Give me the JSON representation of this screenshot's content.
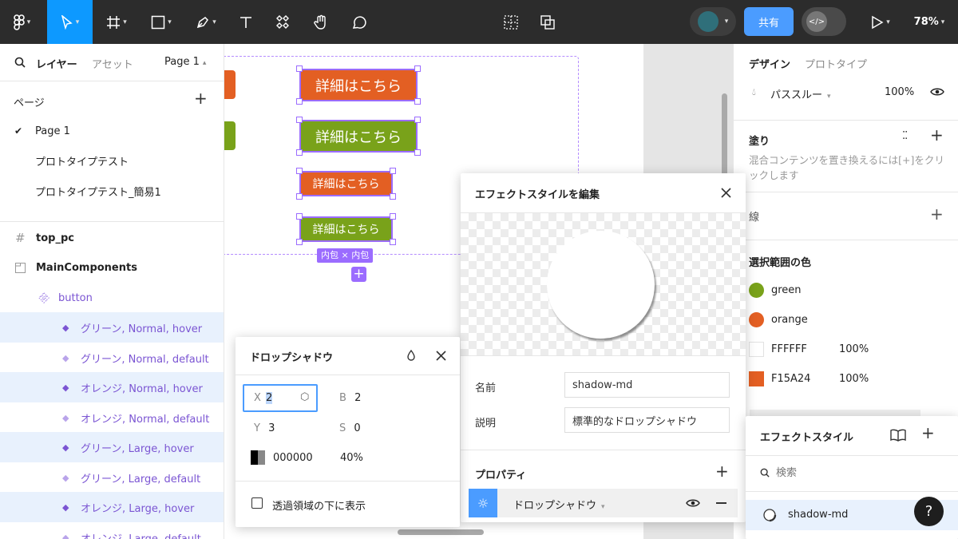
{
  "toolbar": {
    "share_label": "共有",
    "zoom": "78%",
    "colors": {
      "bg": "#2c2c2c",
      "active": "#0d99ff",
      "share": "#4b9cff"
    }
  },
  "left_panel": {
    "tab_layers": "レイヤー",
    "tab_assets": "アセット",
    "page_selector": "Page 1",
    "pages_heading": "ページ",
    "pages": [
      "Page 1",
      "プロトタイプテスト",
      "プロトタイプテスト_簡易1"
    ],
    "layers": [
      {
        "label": "top_pc",
        "icon": "frame-icon"
      },
      {
        "label": "MainComponents",
        "icon": "section-icon"
      },
      {
        "label": "button",
        "icon": "component-set-icon"
      },
      {
        "label": "グリーン, Normal, hover",
        "icon": "variant-icon"
      },
      {
        "label": "グリーン, Normal, default",
        "icon": "variant-icon"
      },
      {
        "label": "オレンジ, Normal, hover",
        "icon": "variant-icon"
      },
      {
        "label": "オレンジ, Normal, default",
        "icon": "variant-icon"
      },
      {
        "label": "グリーン, Large, hover",
        "icon": "variant-icon"
      },
      {
        "label": "グリーン, Large, default",
        "icon": "variant-icon"
      },
      {
        "label": "オレンジ, Large, hover",
        "icon": "variant-icon"
      },
      {
        "label": "オレンジ, Large, default",
        "icon": "variant-icon"
      }
    ]
  },
  "canvas": {
    "buttons": [
      "詳細はこちら",
      "詳細はこちら",
      "詳細はこちら",
      "詳細はこちら"
    ],
    "auto_layout_badge": "内包 × 内包",
    "colors": {
      "orange": "#e35f23",
      "green": "#79a21a",
      "selection": "#9b6cff"
    }
  },
  "drop_shadow": {
    "title": "ドロップシャドウ",
    "x_label": "X",
    "x_value": "2",
    "b_label": "B",
    "b_value": "2",
    "y_label": "Y",
    "y_value": "3",
    "s_label": "S",
    "s_value": "0",
    "color_hex": "000000",
    "opacity": "40%",
    "checkbox_label": "透過領域の下に表示"
  },
  "effect_editor": {
    "title": "エフェクトスタイルを編集",
    "name_label": "名前",
    "name_value": "shadow-md",
    "desc_label": "説明",
    "desc_value": "標準的なドロップシャドウ",
    "properties_label": "プロパティ",
    "effect_type": "ドロップシャドウ"
  },
  "right_panel": {
    "tab_design": "デザイン",
    "tab_prototype": "プロトタイプ",
    "blend_mode": "パススルー",
    "layer_opacity": "100%",
    "fill_heading": "塗り",
    "fill_hint": "混合コンテンツを置き換えるには[+]をクリックします",
    "stroke_heading": "線",
    "selection_colors_heading": "選択範囲の色",
    "selection_colors": [
      {
        "name": "green",
        "color": "#79a21a",
        "opacity": ""
      },
      {
        "name": "orange",
        "color": "#e35f23",
        "opacity": ""
      },
      {
        "name": "FFFFFF",
        "color": "#ffffff",
        "opacity": "100%"
      },
      {
        "name": "F15A24",
        "color": "#e35f23",
        "opacity": "100%"
      }
    ]
  },
  "effect_styles": {
    "title": "エフェクトスタイル",
    "search_placeholder": "検索",
    "items": [
      "shadow-md"
    ]
  },
  "help_label": "?"
}
